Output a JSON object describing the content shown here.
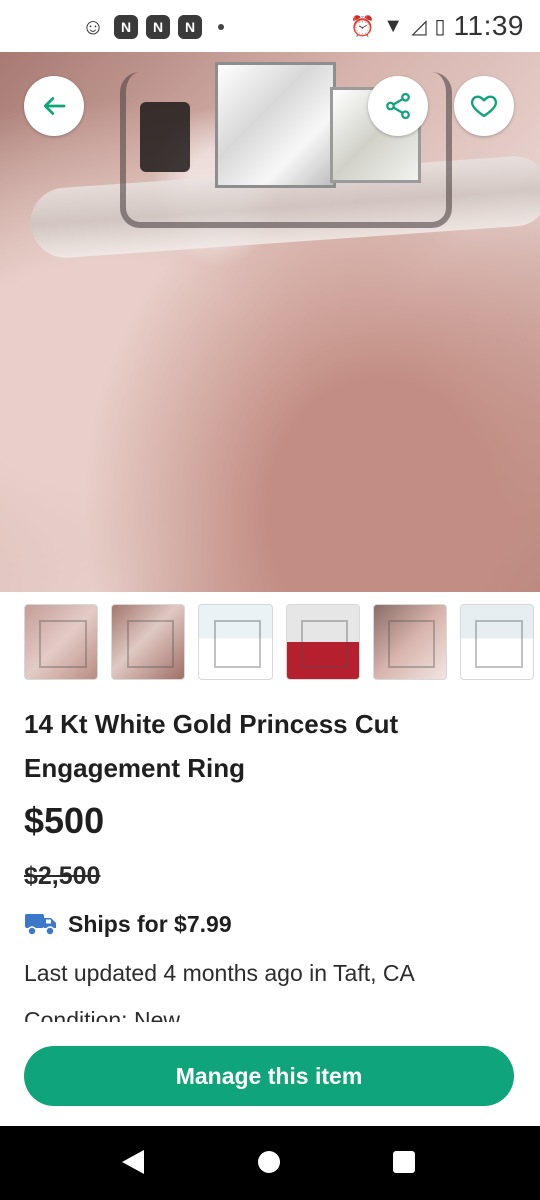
{
  "status_bar": {
    "time": "11:39",
    "icons": [
      "smiley-icon",
      "app-notification-icon",
      "app-notification-icon",
      "app-notification-icon",
      "dot-icon",
      "alarm-icon",
      "wifi-icon",
      "signal-icon",
      "battery-icon"
    ],
    "app_glyph": "N"
  },
  "hero": {
    "back_icon": "arrow-left-icon",
    "share_icon": "share-icon",
    "favorite_icon": "heart-icon"
  },
  "thumbnails": [
    {
      "name": "thumbnail-1"
    },
    {
      "name": "thumbnail-2"
    },
    {
      "name": "thumbnail-3"
    },
    {
      "name": "thumbnail-4"
    },
    {
      "name": "thumbnail-5"
    },
    {
      "name": "thumbnail-6"
    }
  ],
  "listing": {
    "title": "14 Kt White Gold Princess Cut Engagement Ring",
    "price": "$500",
    "original_price": "$2,500",
    "shipping": "Ships for $7.99",
    "last_updated": "Last updated 4 months ago in Taft, CA",
    "condition": "Condition: New"
  },
  "cta": {
    "label": "Manage this item"
  },
  "colors": {
    "accent": "#10a47a",
    "truck": "#3b78c9"
  }
}
